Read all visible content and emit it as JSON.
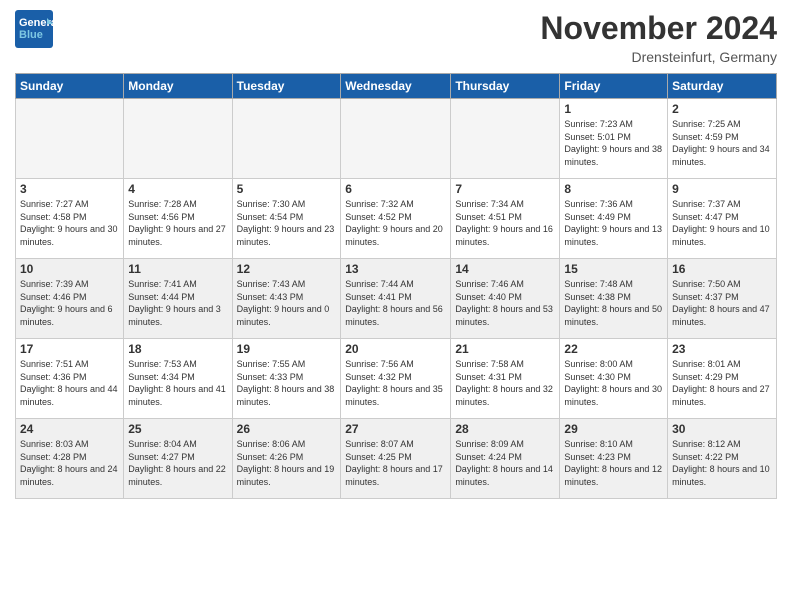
{
  "header": {
    "logo_line1": "General",
    "logo_line2": "Blue",
    "month_title": "November 2024",
    "location": "Drensteinfurt, Germany"
  },
  "days_of_week": [
    "Sunday",
    "Monday",
    "Tuesday",
    "Wednesday",
    "Thursday",
    "Friday",
    "Saturday"
  ],
  "weeks": [
    [
      {
        "day": "",
        "empty": true
      },
      {
        "day": "",
        "empty": true
      },
      {
        "day": "",
        "empty": true
      },
      {
        "day": "",
        "empty": true
      },
      {
        "day": "",
        "empty": true
      },
      {
        "day": "1",
        "sunrise": "7:23 AM",
        "sunset": "5:01 PM",
        "daylight": "9 hours and 38 minutes."
      },
      {
        "day": "2",
        "sunrise": "7:25 AM",
        "sunset": "4:59 PM",
        "daylight": "9 hours and 34 minutes."
      }
    ],
    [
      {
        "day": "3",
        "sunrise": "7:27 AM",
        "sunset": "4:58 PM",
        "daylight": "9 hours and 30 minutes."
      },
      {
        "day": "4",
        "sunrise": "7:28 AM",
        "sunset": "4:56 PM",
        "daylight": "9 hours and 27 minutes."
      },
      {
        "day": "5",
        "sunrise": "7:30 AM",
        "sunset": "4:54 PM",
        "daylight": "9 hours and 23 minutes."
      },
      {
        "day": "6",
        "sunrise": "7:32 AM",
        "sunset": "4:52 PM",
        "daylight": "9 hours and 20 minutes."
      },
      {
        "day": "7",
        "sunrise": "7:34 AM",
        "sunset": "4:51 PM",
        "daylight": "9 hours and 16 minutes."
      },
      {
        "day": "8",
        "sunrise": "7:36 AM",
        "sunset": "4:49 PM",
        "daylight": "9 hours and 13 minutes."
      },
      {
        "day": "9",
        "sunrise": "7:37 AM",
        "sunset": "4:47 PM",
        "daylight": "9 hours and 10 minutes."
      }
    ],
    [
      {
        "day": "10",
        "sunrise": "7:39 AM",
        "sunset": "4:46 PM",
        "daylight": "9 hours and 6 minutes."
      },
      {
        "day": "11",
        "sunrise": "7:41 AM",
        "sunset": "4:44 PM",
        "daylight": "9 hours and 3 minutes."
      },
      {
        "day": "12",
        "sunrise": "7:43 AM",
        "sunset": "4:43 PM",
        "daylight": "9 hours and 0 minutes."
      },
      {
        "day": "13",
        "sunrise": "7:44 AM",
        "sunset": "4:41 PM",
        "daylight": "8 hours and 56 minutes."
      },
      {
        "day": "14",
        "sunrise": "7:46 AM",
        "sunset": "4:40 PM",
        "daylight": "8 hours and 53 minutes."
      },
      {
        "day": "15",
        "sunrise": "7:48 AM",
        "sunset": "4:38 PM",
        "daylight": "8 hours and 50 minutes."
      },
      {
        "day": "16",
        "sunrise": "7:50 AM",
        "sunset": "4:37 PM",
        "daylight": "8 hours and 47 minutes."
      }
    ],
    [
      {
        "day": "17",
        "sunrise": "7:51 AM",
        "sunset": "4:36 PM",
        "daylight": "8 hours and 44 minutes."
      },
      {
        "day": "18",
        "sunrise": "7:53 AM",
        "sunset": "4:34 PM",
        "daylight": "8 hours and 41 minutes."
      },
      {
        "day": "19",
        "sunrise": "7:55 AM",
        "sunset": "4:33 PM",
        "daylight": "8 hours and 38 minutes."
      },
      {
        "day": "20",
        "sunrise": "7:56 AM",
        "sunset": "4:32 PM",
        "daylight": "8 hours and 35 minutes."
      },
      {
        "day": "21",
        "sunrise": "7:58 AM",
        "sunset": "4:31 PM",
        "daylight": "8 hours and 32 minutes."
      },
      {
        "day": "22",
        "sunrise": "8:00 AM",
        "sunset": "4:30 PM",
        "daylight": "8 hours and 30 minutes."
      },
      {
        "day": "23",
        "sunrise": "8:01 AM",
        "sunset": "4:29 PM",
        "daylight": "8 hours and 27 minutes."
      }
    ],
    [
      {
        "day": "24",
        "sunrise": "8:03 AM",
        "sunset": "4:28 PM",
        "daylight": "8 hours and 24 minutes."
      },
      {
        "day": "25",
        "sunrise": "8:04 AM",
        "sunset": "4:27 PM",
        "daylight": "8 hours and 22 minutes."
      },
      {
        "day": "26",
        "sunrise": "8:06 AM",
        "sunset": "4:26 PM",
        "daylight": "8 hours and 19 minutes."
      },
      {
        "day": "27",
        "sunrise": "8:07 AM",
        "sunset": "4:25 PM",
        "daylight": "8 hours and 17 minutes."
      },
      {
        "day": "28",
        "sunrise": "8:09 AM",
        "sunset": "4:24 PM",
        "daylight": "8 hours and 14 minutes."
      },
      {
        "day": "29",
        "sunrise": "8:10 AM",
        "sunset": "4:23 PM",
        "daylight": "8 hours and 12 minutes."
      },
      {
        "day": "30",
        "sunrise": "8:12 AM",
        "sunset": "4:22 PM",
        "daylight": "8 hours and 10 minutes."
      }
    ]
  ],
  "labels": {
    "sunrise": "Sunrise:",
    "sunset": "Sunset:",
    "daylight": "Daylight:"
  }
}
